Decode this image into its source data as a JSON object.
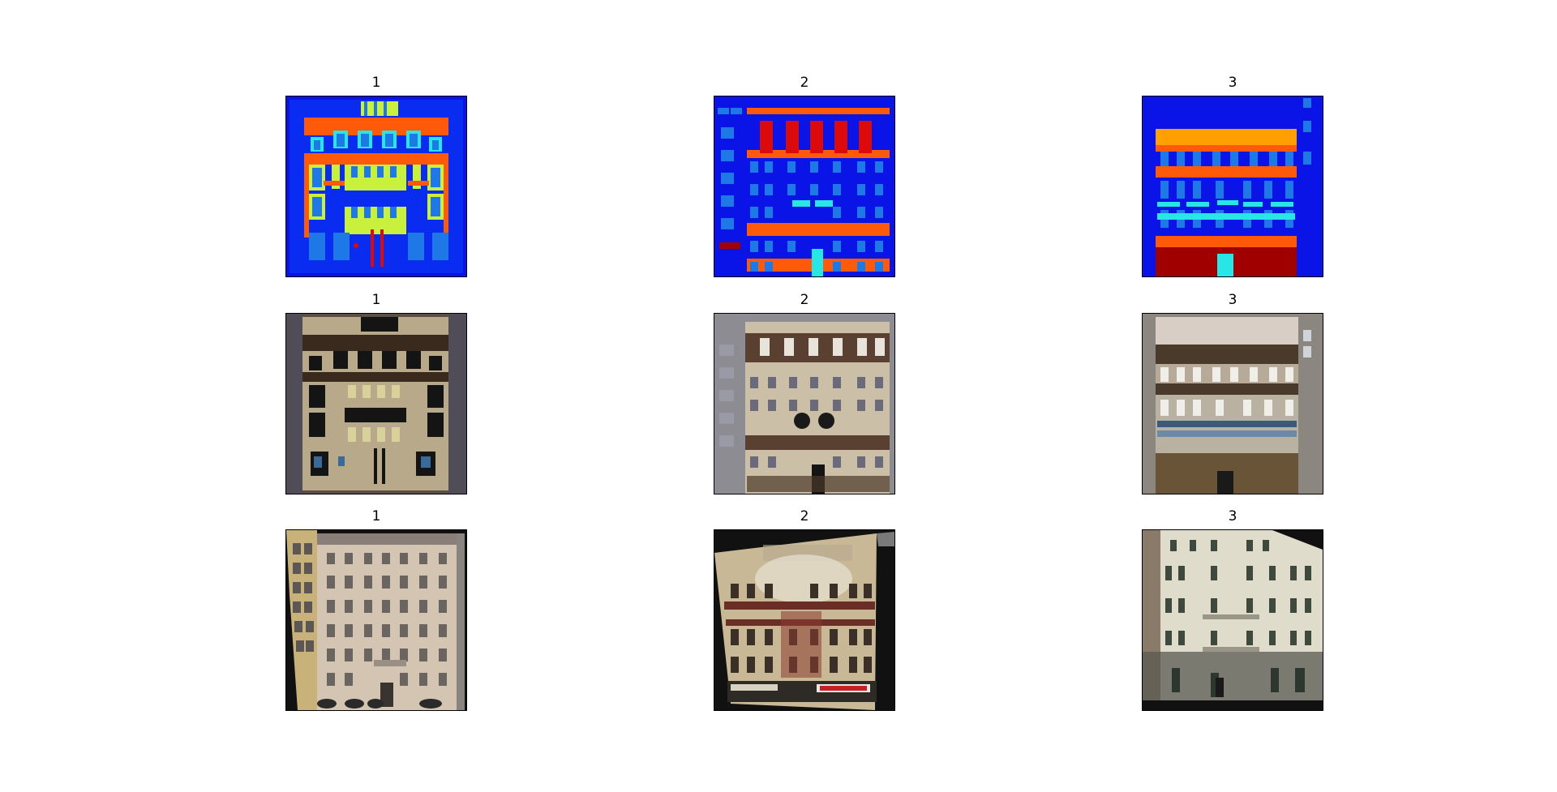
{
  "panels": [
    {
      "title": "1"
    },
    {
      "title": "2"
    },
    {
      "title": "3"
    },
    {
      "title": "1"
    },
    {
      "title": "2"
    },
    {
      "title": "3"
    },
    {
      "title": "1"
    },
    {
      "title": "2"
    },
    {
      "title": "3"
    }
  ],
  "colors": {
    "label_blue": "#0a14e6",
    "label_orange": "#ff5a0a",
    "label_cyan": "#28e6e6",
    "label_lime": "#c8f03c",
    "label_red": "#dc0a0a",
    "label_darkred": "#a00000",
    "label_midblue": "#1e78e6",
    "photo_beige": "#d9c8a8",
    "photo_black": "#111111"
  }
}
